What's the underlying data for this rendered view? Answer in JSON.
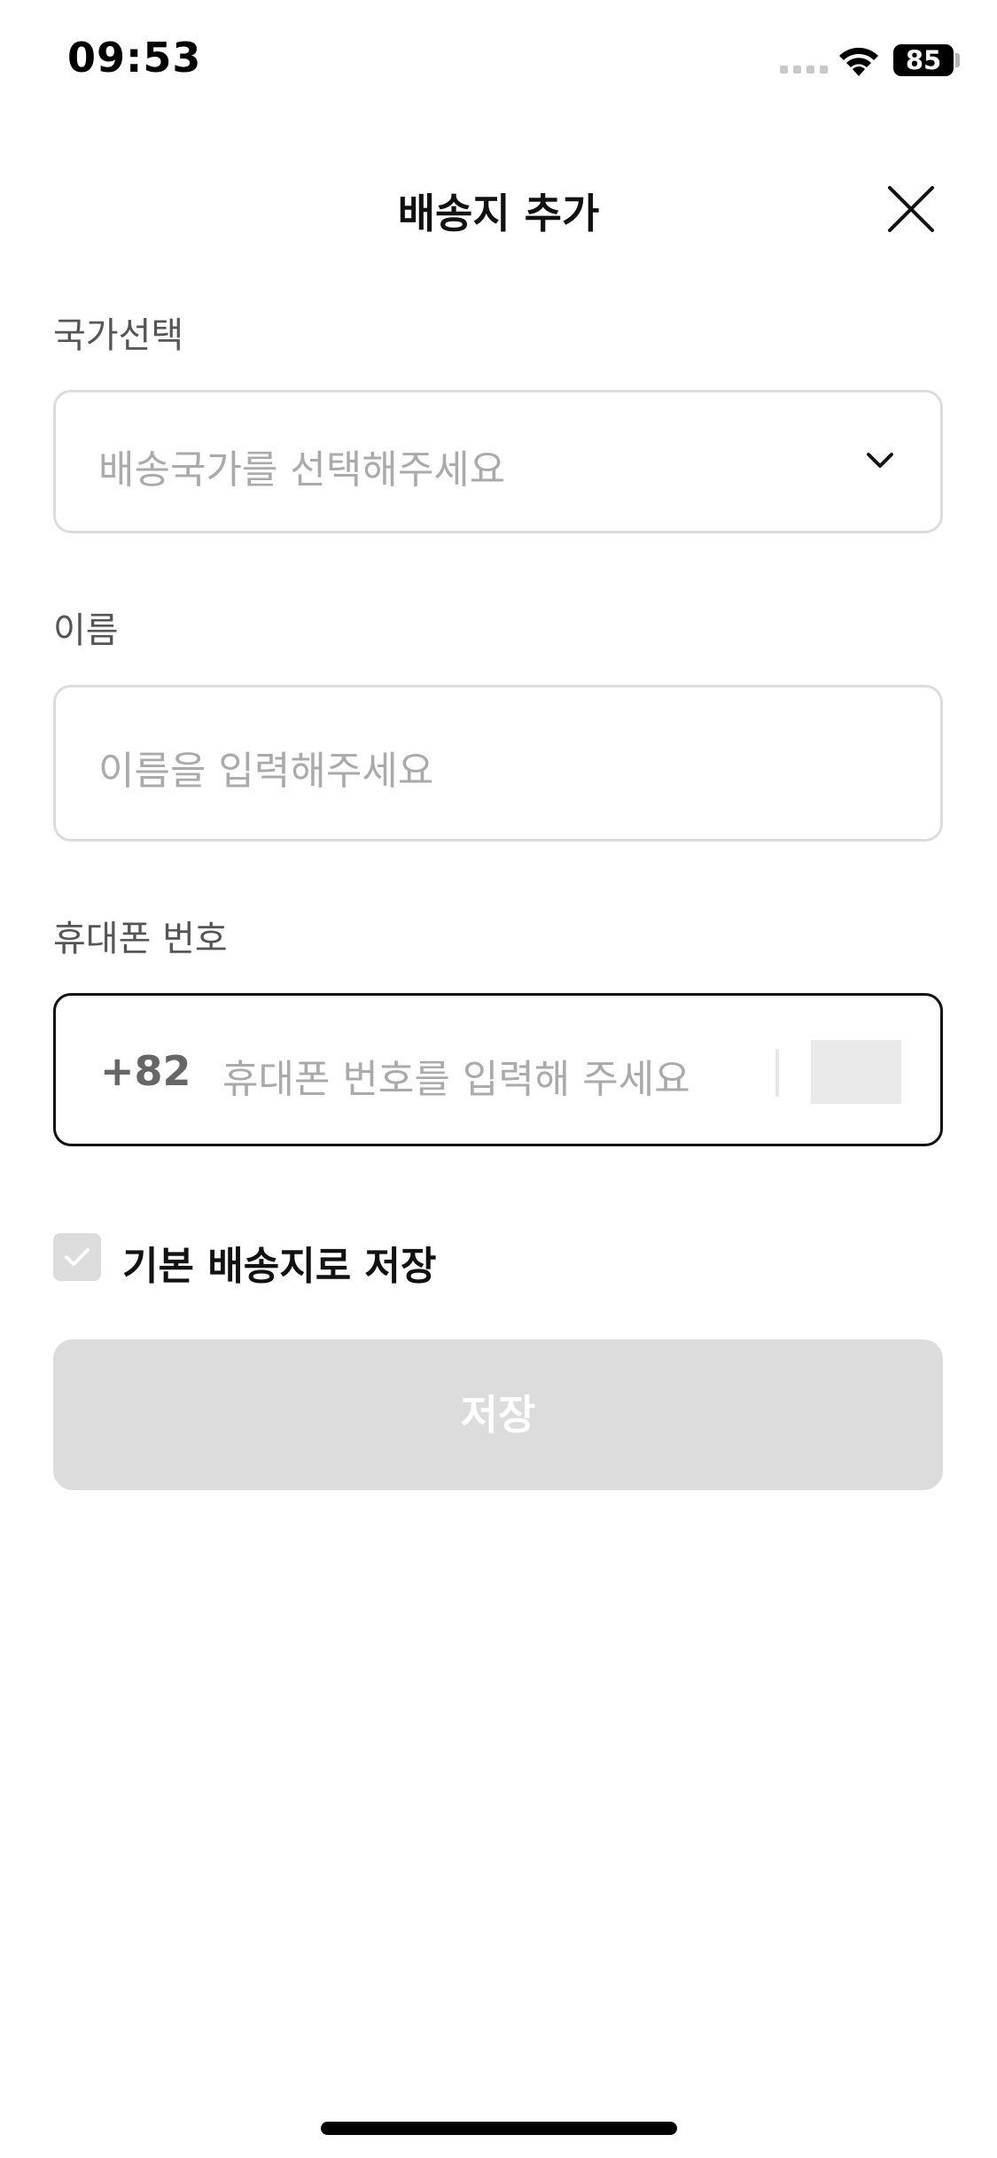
{
  "status_bar": {
    "time": "09:53",
    "battery": "85"
  },
  "header": {
    "title": "배송지 추가",
    "close_icon": "close-icon"
  },
  "form": {
    "country": {
      "label": "국가선택",
      "placeholder": "배송국가를 선택해주세요",
      "icon": "chevron-down-icon"
    },
    "name": {
      "label": "이름",
      "placeholder": "이름을 입력해주세요"
    },
    "phone": {
      "label": "휴대폰 번호",
      "country_code": "+82",
      "placeholder": "휴대폰 번호를 입력해 주세요"
    },
    "default_address": {
      "label": "기본 배송지로 저장",
      "checked": false
    },
    "save_label": "저장"
  },
  "colors": {
    "text_primary": "#111111",
    "label": "#555555",
    "placeholder": "#aaaaaa",
    "border": "#dcdcdc",
    "disabled_button": "#dcdcdc"
  }
}
